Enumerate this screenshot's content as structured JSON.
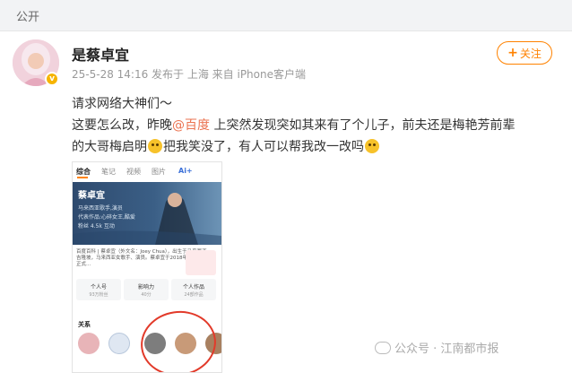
{
  "header": {
    "visibility": "公开"
  },
  "user": {
    "name": "是蔡卓宜",
    "meta": "25-5-28 14:16 发布于 上海 来自 iPhone客户端"
  },
  "follow_label": "关注",
  "post": {
    "line1": "请求网络大神们～",
    "line2_a": "这要怎么改，昨晚",
    "mention": "@百度",
    "line2_b": " 上突然发现突如其来有了个儿子，前夫还是梅艳芳前辈",
    "line3_a": "的大哥梅启明",
    "line3_b": "把我笑没了，有人可以帮我改一改吗"
  },
  "screenshot": {
    "tabs": [
      "综合",
      "笔记",
      "视频",
      "图片",
      "Ai+",
      " "
    ],
    "name": "蔡卓宜",
    "desc": [
      "马来西亚歌手,演员",
      "代表作品:心碎女王,酷爱",
      "粉丝 4.5k 互动"
    ],
    "info": "百度百科 | 蔡卓宜（外文名：Joey Chua），出生于马来西亚吉隆坡，马来西亚女歌手、演员。蔡卓宜于2018年出版个人正式...",
    "stats": [
      {
        "label": "个人号",
        "value": "93万粉丝"
      },
      {
        "label": "影响力",
        "value": "40分"
      },
      {
        "label": "个人作品",
        "value": "24部作品"
      }
    ],
    "relations_label": "关系"
  },
  "watermark": "公众号 · 江南都市报"
}
